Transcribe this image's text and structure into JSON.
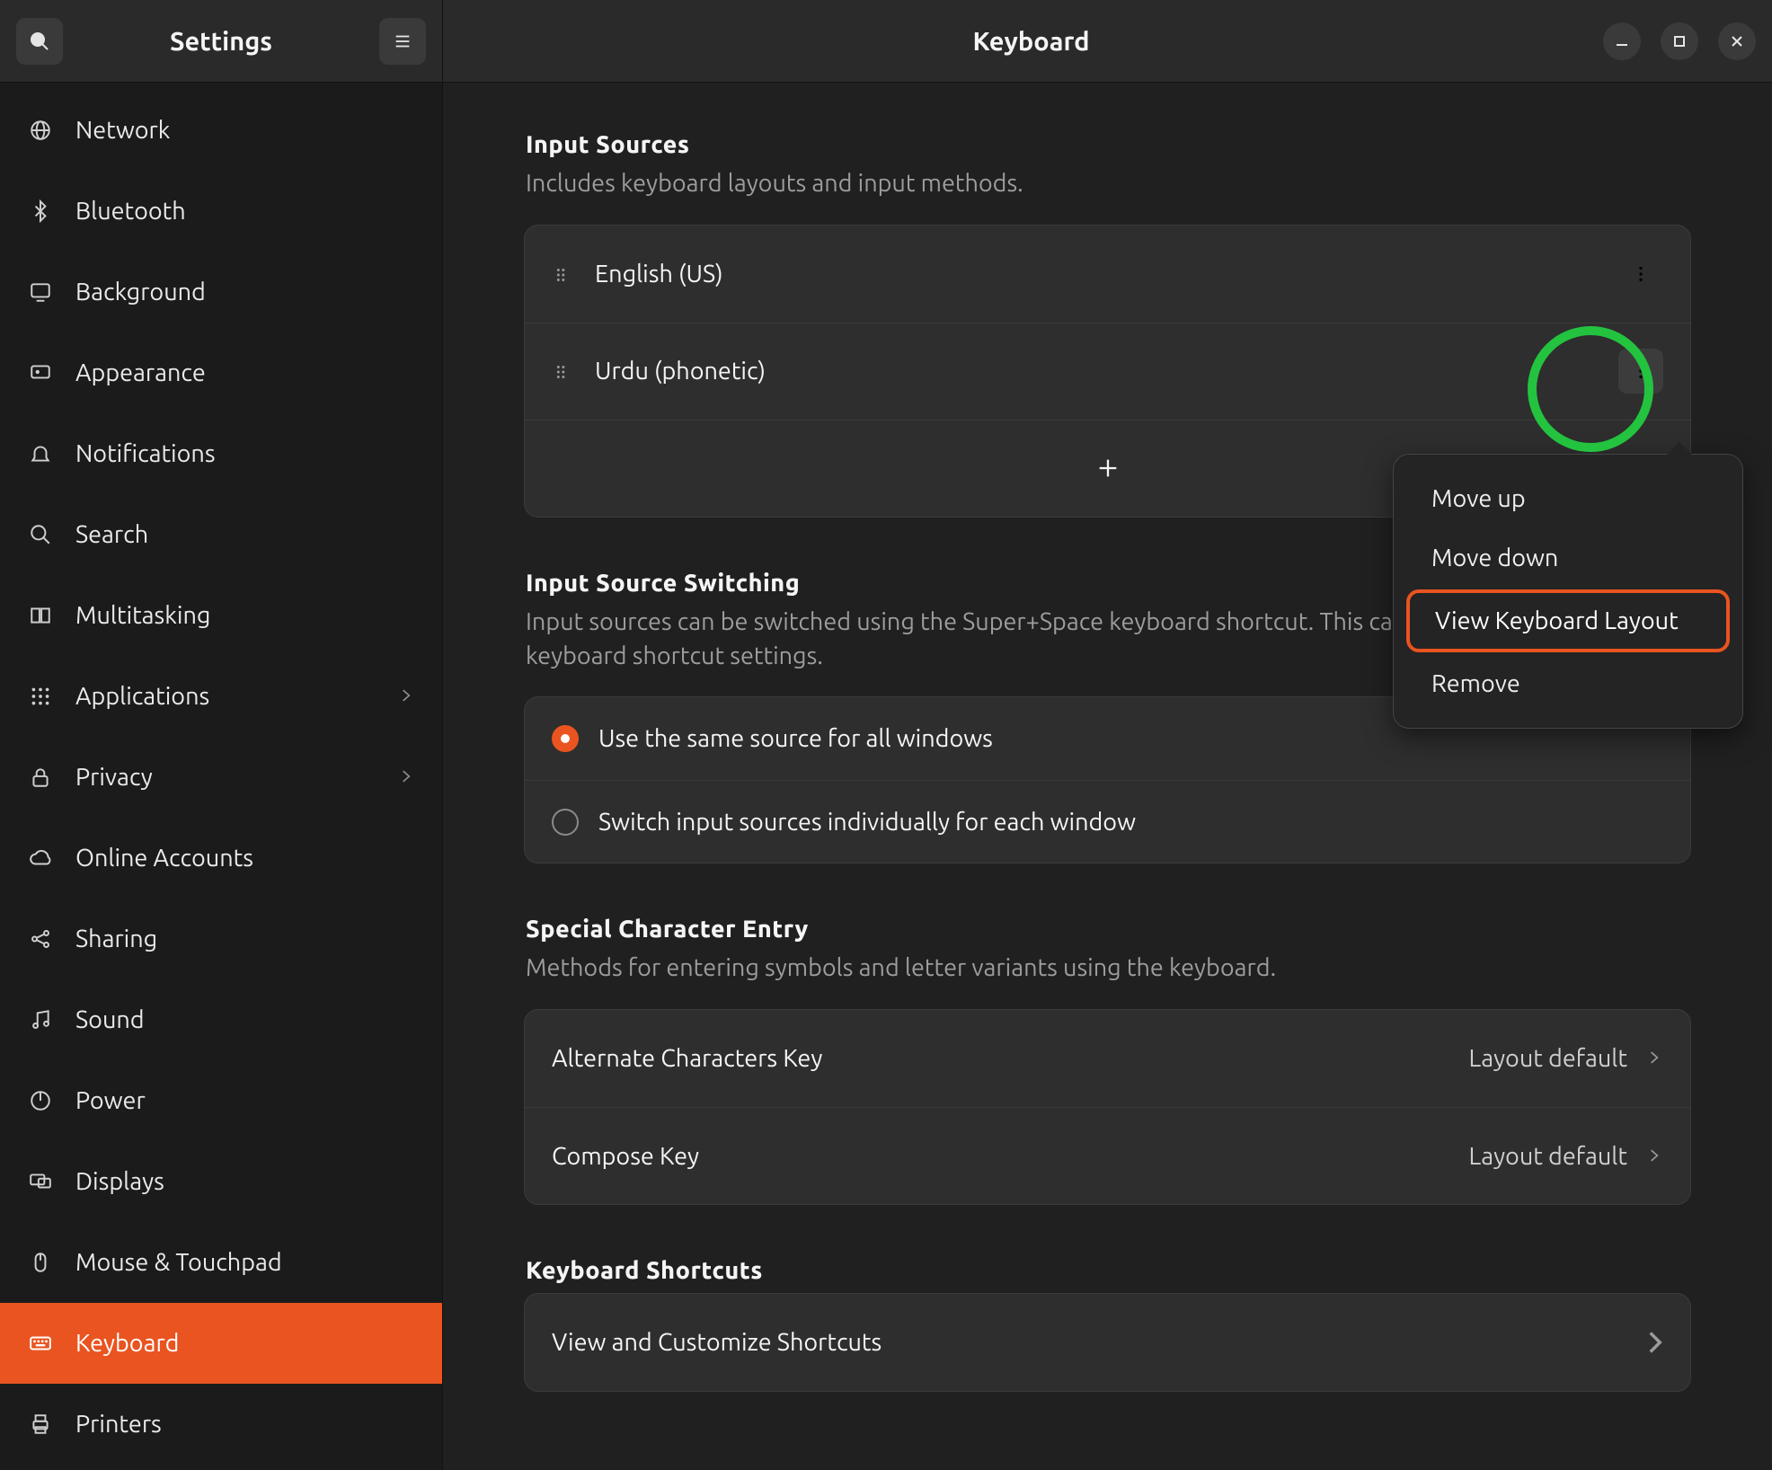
{
  "colors": {
    "accent": "#e95420",
    "highlight_ring": "#23c33f"
  },
  "titlebar": {
    "app_title": "Settings",
    "page_title": "Keyboard"
  },
  "sidebar": {
    "items": [
      {
        "id": "network",
        "label": "Network",
        "icon": "globe"
      },
      {
        "id": "bluetooth",
        "label": "Bluetooth",
        "icon": "bluetooth"
      },
      {
        "id": "background",
        "label": "Background",
        "icon": "monitor"
      },
      {
        "id": "appearance",
        "label": "Appearance",
        "icon": "appearance"
      },
      {
        "id": "notifications",
        "label": "Notifications",
        "icon": "bell"
      },
      {
        "id": "search",
        "label": "Search",
        "icon": "search"
      },
      {
        "id": "multitasking",
        "label": "Multitasking",
        "icon": "multitask"
      },
      {
        "id": "applications",
        "label": "Applications",
        "icon": "apps",
        "submenu": true
      },
      {
        "id": "privacy",
        "label": "Privacy",
        "icon": "lock",
        "submenu": true
      },
      {
        "id": "online-accounts",
        "label": "Online Accounts",
        "icon": "cloud"
      },
      {
        "id": "sharing",
        "label": "Sharing",
        "icon": "share"
      },
      {
        "id": "sound",
        "label": "Sound",
        "icon": "music"
      },
      {
        "id": "power",
        "label": "Power",
        "icon": "power"
      },
      {
        "id": "displays",
        "label": "Displays",
        "icon": "displays"
      },
      {
        "id": "mouse",
        "label": "Mouse & Touchpad",
        "icon": "mouse"
      },
      {
        "id": "keyboard",
        "label": "Keyboard",
        "icon": "keyboard",
        "selected": true
      },
      {
        "id": "printers",
        "label": "Printers",
        "icon": "printer"
      }
    ]
  },
  "sections": {
    "input_sources": {
      "title": "Input Sources",
      "desc": "Includes keyboard layouts and input methods.",
      "items": [
        {
          "label": "English (US)"
        },
        {
          "label": "Urdu (phonetic)",
          "menu_open": true
        }
      ]
    },
    "switching": {
      "title": "Input Source Switching",
      "desc": "Input sources can be switched using the Super+Space keyboard shortcut. This can be changed in the keyboard shortcut settings.",
      "options": [
        {
          "label": "Use the same source for all windows",
          "checked": true
        },
        {
          "label": "Switch input sources individually for each window",
          "checked": false
        }
      ]
    },
    "special": {
      "title": "Special Character Entry",
      "desc": "Methods for entering symbols and letter variants using the keyboard.",
      "rows": [
        {
          "label": "Alternate Characters Key",
          "value": "Layout default"
        },
        {
          "label": "Compose Key",
          "value": "Layout default"
        }
      ]
    },
    "shortcuts": {
      "title": "Keyboard Shortcuts",
      "row_label": "View and Customize Shortcuts"
    }
  },
  "popover": {
    "items": [
      {
        "label": "Move up",
        "id": "move-up"
      },
      {
        "label": "Move down",
        "id": "move-down"
      },
      {
        "label": "View Keyboard Layout",
        "id": "view-layout",
        "highlight": true
      },
      {
        "label": "Remove",
        "id": "remove"
      }
    ]
  }
}
